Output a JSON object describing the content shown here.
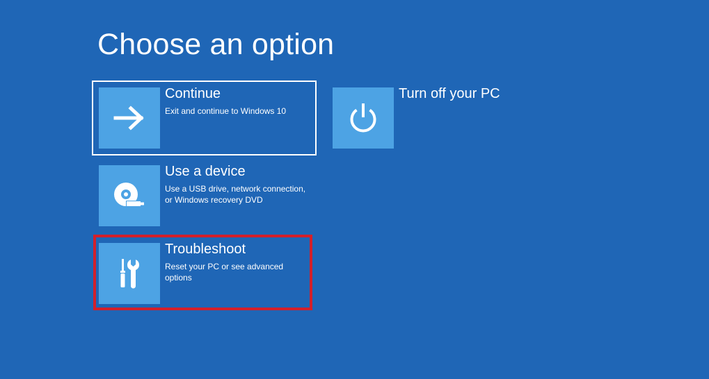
{
  "page": {
    "title": "Choose an option"
  },
  "options": {
    "continue": {
      "title": "Continue",
      "description": "Exit and continue to Windows 10",
      "icon": "arrow-right-icon"
    },
    "use_device": {
      "title": "Use a device",
      "description": "Use a USB drive, network connection,\nor Windows recovery DVD",
      "icon": "disc-usb-icon"
    },
    "troubleshoot": {
      "title": "Troubleshoot",
      "description": "Reset your PC or see advanced options",
      "icon": "tools-icon"
    },
    "turn_off": {
      "title": "Turn off your PC",
      "icon": "power-icon"
    }
  },
  "colors": {
    "background": "#1f66b6",
    "tile": "#4da3e4",
    "selection_border": "#ffffff",
    "highlight": "#d3202b"
  }
}
